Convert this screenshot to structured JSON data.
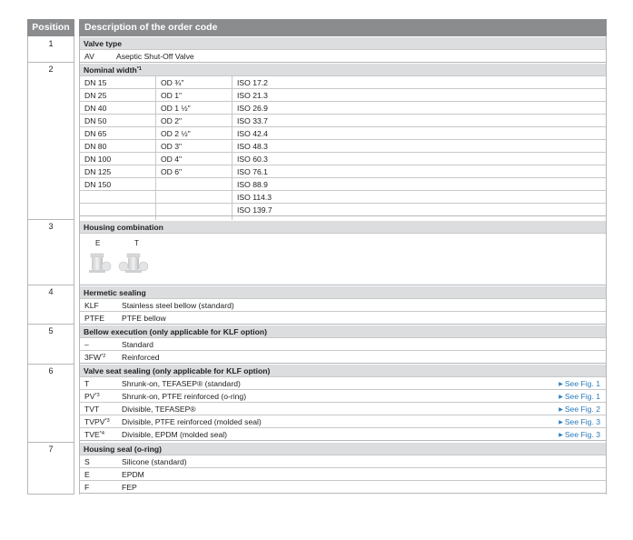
{
  "header": {
    "position": "Position",
    "description": "Description of the order code"
  },
  "rows": [
    {
      "pos": "1"
    },
    {
      "pos": "2"
    },
    {
      "pos": "3"
    },
    {
      "pos": "4"
    },
    {
      "pos": "5"
    },
    {
      "pos": "6"
    },
    {
      "pos": "7"
    }
  ],
  "valve_type": {
    "title": "Valve type",
    "code": "AV",
    "label": "Aseptic Shut-Off Valve"
  },
  "nominal_width": {
    "title": "Nominal width",
    "note": "*1",
    "dn": [
      "DN 15",
      "DN 25",
      "DN 40",
      "DN 50",
      "DN 65",
      "DN 80",
      "DN 100",
      "DN 125",
      "DN 150"
    ],
    "od": [
      "OD ¾\"",
      "OD 1\"",
      "OD 1 ½\"",
      "OD 2\"",
      "OD 2 ½\"",
      "OD 3\"",
      "OD 4\"",
      "OD 6\""
    ],
    "iso": [
      "ISO 17.2",
      "ISO 21.3",
      "ISO 26.9",
      "ISO 33.7",
      "ISO 42.4",
      "ISO 48.3",
      "ISO 60.3",
      "ISO 76.1",
      "ISO 88.9",
      "ISO 114.3",
      "ISO 139.7"
    ]
  },
  "housing": {
    "title": "Housing combination",
    "labels": [
      "E",
      "T"
    ]
  },
  "hermetic": {
    "title": "Hermetic sealing",
    "items": [
      {
        "code": "KLF",
        "label": "Stainless steel bellow (standard)"
      },
      {
        "code": "PTFE",
        "label": "PTFE bellow"
      }
    ]
  },
  "bellow": {
    "title": "Bellow execution (only applicable for KLF option)",
    "items": [
      {
        "code": "–",
        "note": "",
        "label": "Standard"
      },
      {
        "code": "3FW",
        "note": "*2",
        "label": "Reinforced"
      }
    ]
  },
  "seat": {
    "title": "Valve seat sealing (only applicable for KLF option)",
    "items": [
      {
        "code": "T",
        "note": "",
        "label": "Shrunk-on, TEFASEP® (standard)",
        "fig": "See Fig. 1"
      },
      {
        "code": "PV",
        "note": "*3",
        "label": "Shrunk-on, PTFE reinforced (o-ring)",
        "fig": "See Fig. 1"
      },
      {
        "code": "TVT",
        "note": "",
        "label": "Divisible, TEFASEP®",
        "fig": "See Fig. 2"
      },
      {
        "code": "TVPV",
        "note": "*3",
        "label": "Divisible, PTFE reinforced (molded seal)",
        "fig": "See Fig. 3"
      },
      {
        "code": "TVE",
        "note": "*4",
        "label": "Divisible, EPDM (molded seal)",
        "fig": "See Fig. 3"
      }
    ]
  },
  "seal": {
    "title": "Housing seal (o-ring)",
    "items": [
      {
        "code": "S",
        "label": "Silicone (standard)"
      },
      {
        "code": "E",
        "label": "EPDM"
      },
      {
        "code": "F",
        "label": "FEP"
      }
    ]
  },
  "colors": {
    "header": "#8a8c8e",
    "section": "#dcdddf",
    "link": "#2a7bbd",
    "border": "#b5b7b9"
  }
}
